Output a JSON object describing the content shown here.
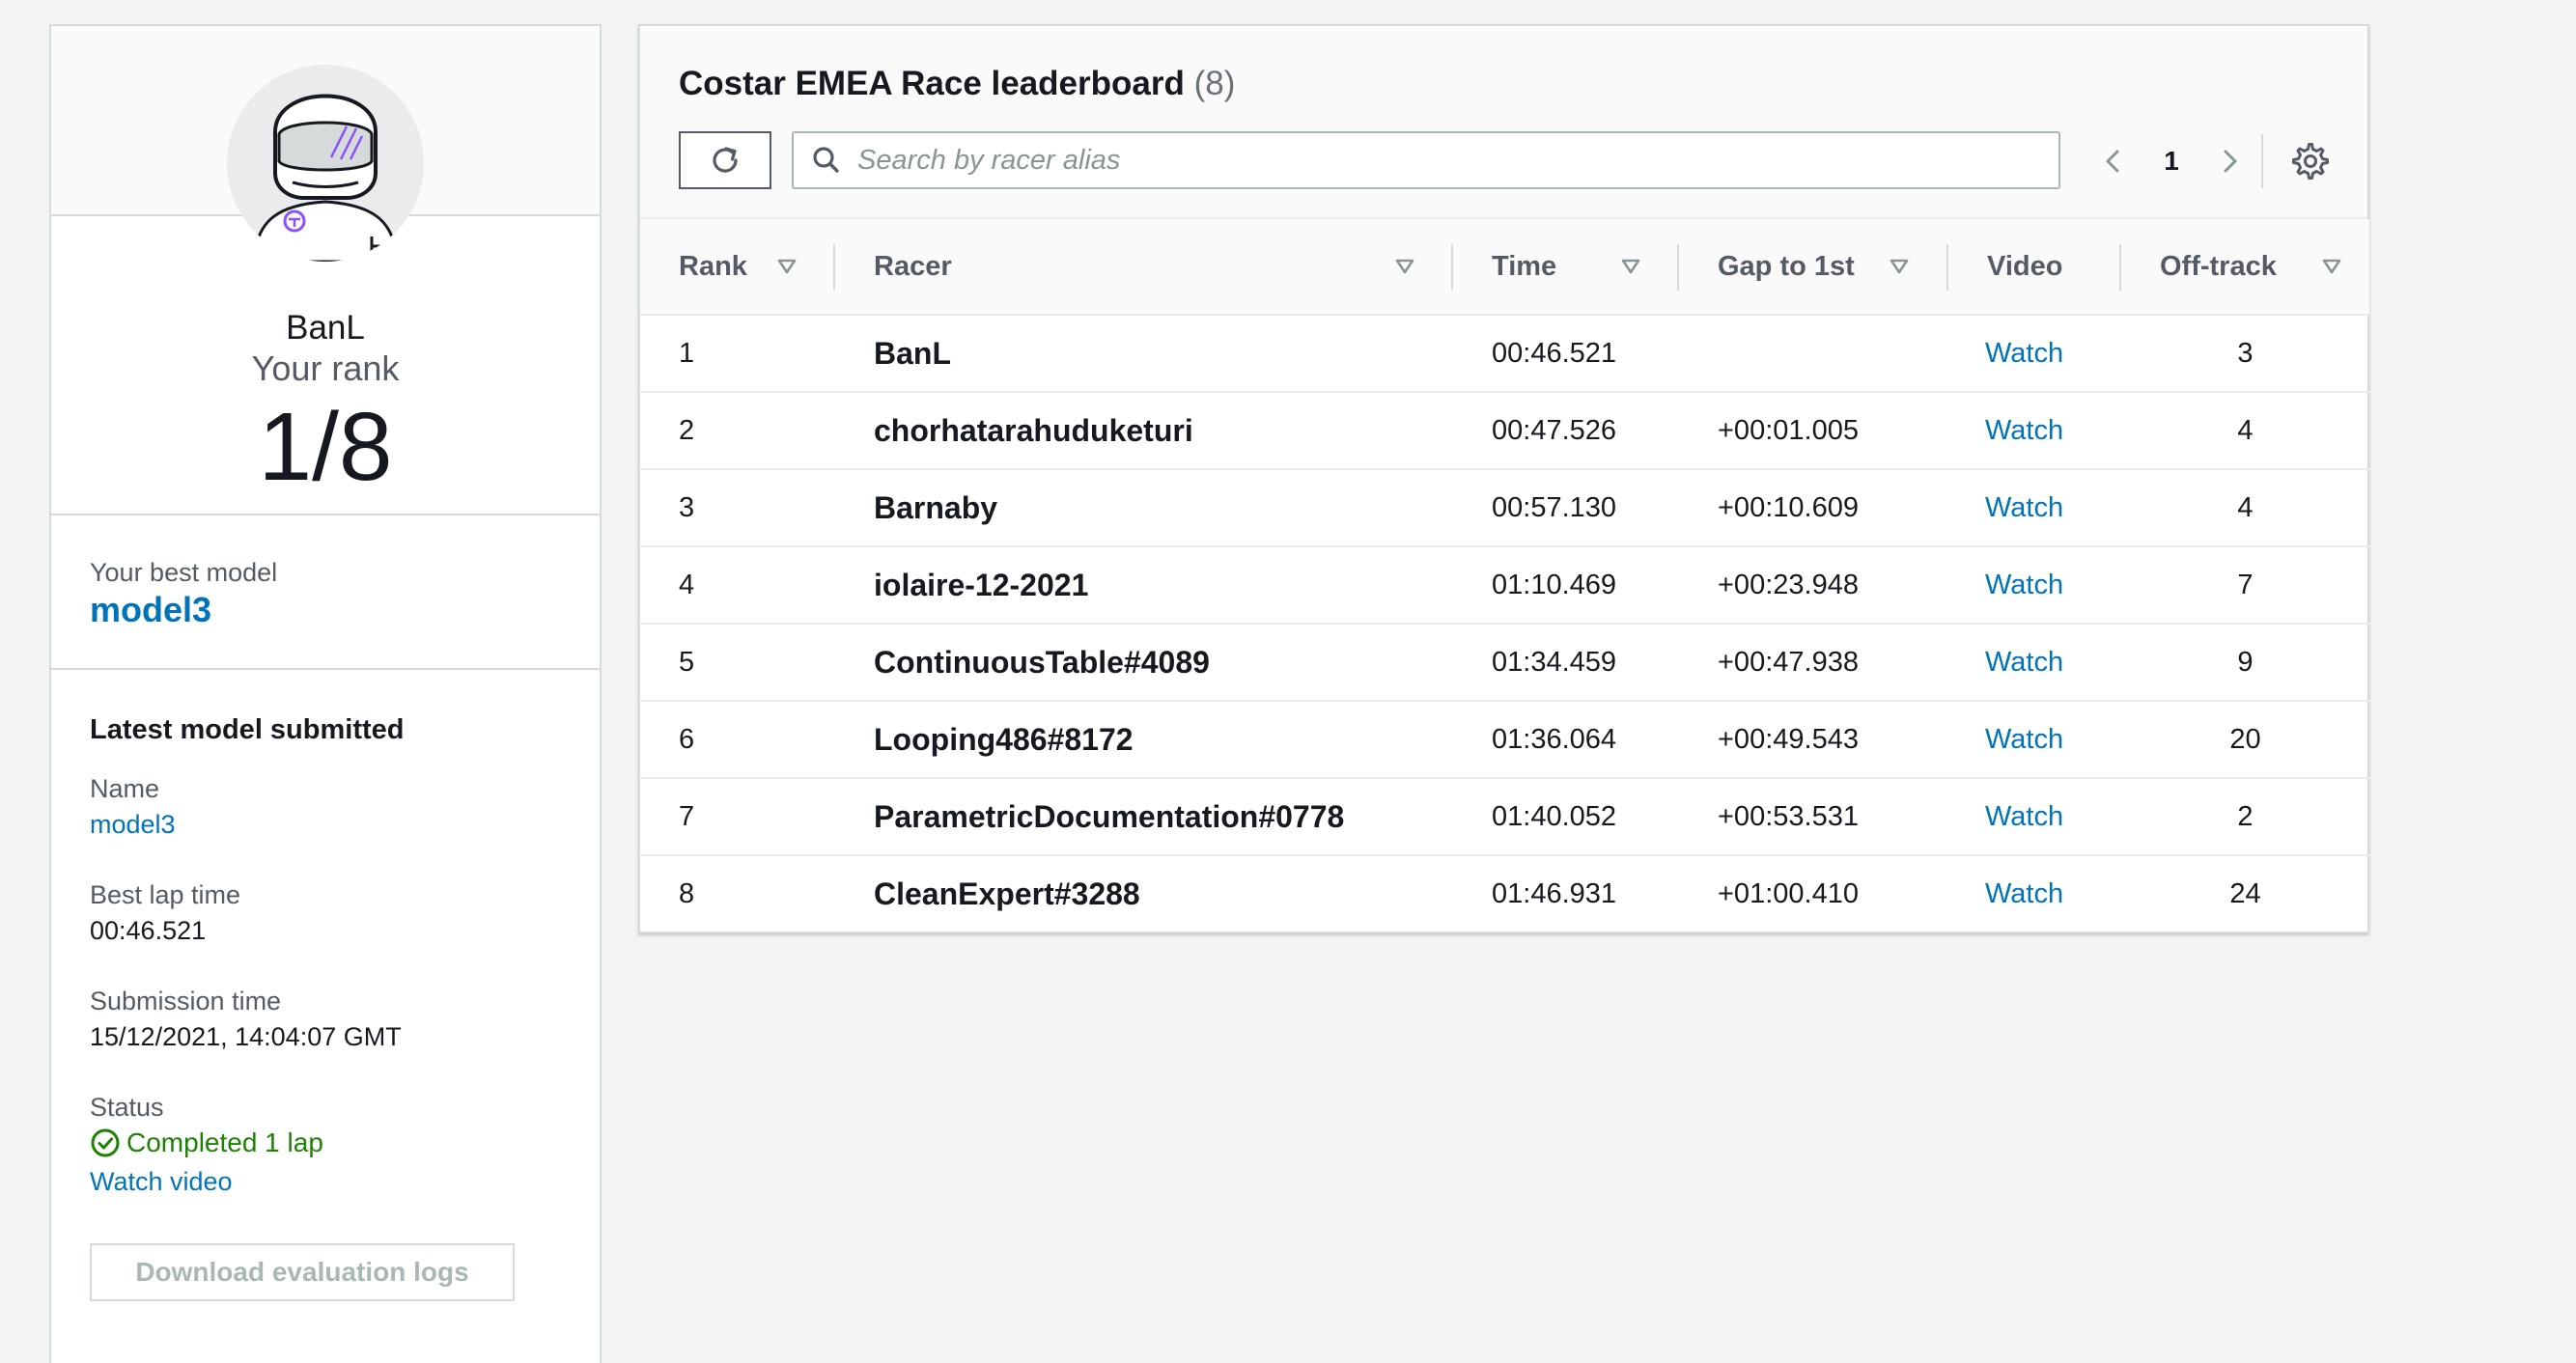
{
  "profile": {
    "racer_name": "BanL",
    "your_rank_label": "Your rank",
    "rank": "1/8",
    "best_model_label": "Your best model",
    "best_model": "model3",
    "latest_title": "Latest model submitted",
    "name_label": "Name",
    "name_value": "model3",
    "best_lap_label": "Best lap time",
    "best_lap_value": "00:46.521",
    "submission_label": "Submission time",
    "submission_value": "15/12/2021, 14:04:07 GMT",
    "status_label": "Status",
    "status_value": "Completed 1 lap",
    "watch_video": "Watch video",
    "download_logs": "Download evaluation logs"
  },
  "leaderboard": {
    "title": "Costar EMEA Race leaderboard",
    "count": "(8)",
    "search_placeholder": "Search by racer alias",
    "page": "1",
    "columns": {
      "rank": "Rank",
      "racer": "Racer",
      "time": "Time",
      "gap": "Gap to 1st",
      "video": "Video",
      "offtrack": "Off-track"
    },
    "rows": [
      {
        "rank": "1",
        "racer": "BanL",
        "time": "00:46.521",
        "gap": "",
        "video": "Watch",
        "offtrack": "3"
      },
      {
        "rank": "2",
        "racer": "chorhatarahuduketuri",
        "time": "00:47.526",
        "gap": "+00:01.005",
        "video": "Watch",
        "offtrack": "4"
      },
      {
        "rank": "3",
        "racer": "Barnaby",
        "time": "00:57.130",
        "gap": "+00:10.609",
        "video": "Watch",
        "offtrack": "4"
      },
      {
        "rank": "4",
        "racer": "iolaire-12-2021",
        "time": "01:10.469",
        "gap": "+00:23.948",
        "video": "Watch",
        "offtrack": "7"
      },
      {
        "rank": "5",
        "racer": "ContinuousTable#4089",
        "time": "01:34.459",
        "gap": "+00:47.938",
        "video": "Watch",
        "offtrack": "9"
      },
      {
        "rank": "6",
        "racer": "Looping486#8172",
        "time": "01:36.064",
        "gap": "+00:49.543",
        "video": "Watch",
        "offtrack": "20"
      },
      {
        "rank": "7",
        "racer": "ParametricDocumentation#0778",
        "time": "01:40.052",
        "gap": "+00:53.531",
        "video": "Watch",
        "offtrack": "2"
      },
      {
        "rank": "8",
        "racer": "CleanExpert#3288",
        "time": "01:46.931",
        "gap": "+01:00.410",
        "video": "Watch",
        "offtrack": "24"
      }
    ]
  },
  "colors": {
    "link": "#0073bb",
    "success": "#1d8102",
    "background": "#f2f3f3",
    "helmet_accent": "#8c4fff"
  },
  "icons": [
    "racer-avatar-icon",
    "check-circle-icon",
    "refresh-icon",
    "search-icon",
    "chevron-left-icon",
    "chevron-right-icon",
    "gear-icon",
    "sort-caret-icon"
  ]
}
